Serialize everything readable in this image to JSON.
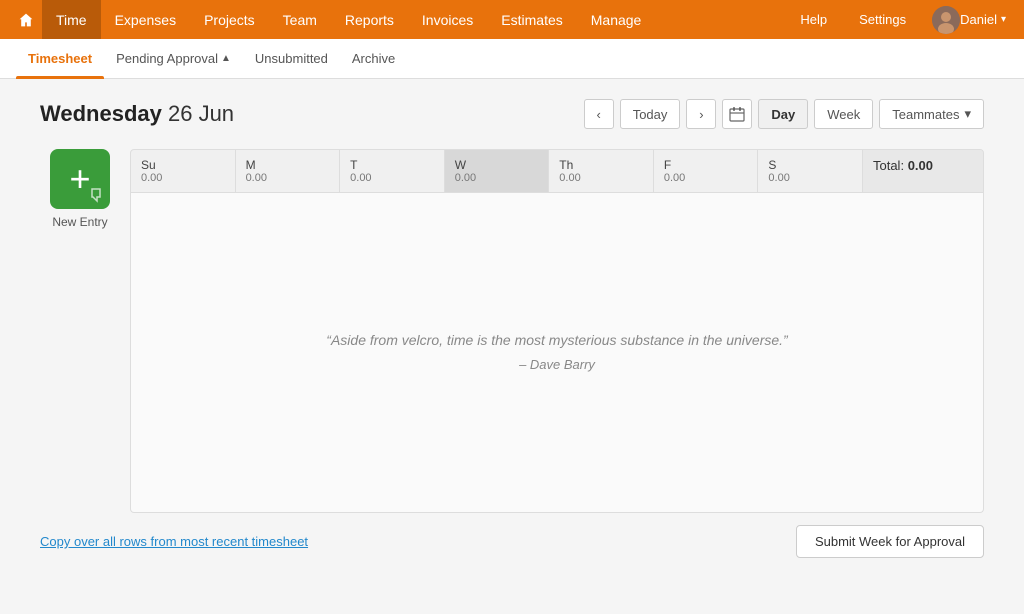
{
  "nav": {
    "home_icon": "⌂",
    "items": [
      {
        "label": "Time",
        "active": true
      },
      {
        "label": "Expenses",
        "active": false
      },
      {
        "label": "Projects",
        "active": false
      },
      {
        "label": "Team",
        "active": false
      },
      {
        "label": "Reports",
        "active": false
      },
      {
        "label": "Invoices",
        "active": false
      },
      {
        "label": "Estimates",
        "active": false
      },
      {
        "label": "Manage",
        "active": false
      }
    ],
    "help_label": "Help",
    "settings_label": "Settings",
    "user_label": "Daniel"
  },
  "sub_tabs": [
    {
      "label": "Timesheet",
      "active": true,
      "dot": false
    },
    {
      "label": "Pending Approval",
      "active": false,
      "dot": true
    },
    {
      "label": "Unsubmitted",
      "active": false,
      "dot": false
    },
    {
      "label": "Archive",
      "active": false,
      "dot": false
    }
  ],
  "date_display": {
    "day_name": "Wednesday",
    "date": "26 Jun"
  },
  "controls": {
    "prev_label": "‹",
    "next_label": "›",
    "today_label": "Today",
    "calendar_icon": "📅",
    "day_label": "Day",
    "week_label": "Week",
    "teammates_label": "Teammates",
    "chevron": "▾"
  },
  "new_entry": {
    "icon": "+",
    "label": "New Entry"
  },
  "grid": {
    "columns": [
      {
        "day": "Su",
        "value": "0.00"
      },
      {
        "day": "M",
        "value": "0.00"
      },
      {
        "day": "T",
        "value": "0.00"
      },
      {
        "day": "W",
        "value": "0.00",
        "active": true
      },
      {
        "day": "Th",
        "value": "0.00"
      },
      {
        "day": "F",
        "value": "0.00"
      },
      {
        "day": "S",
        "value": "0.00"
      }
    ],
    "total_label": "Total:",
    "total_value": "0.00",
    "quote": "“Aside from velcro, time is the most mysterious substance in the universe.”",
    "attribution": "– Dave Barry"
  },
  "footer": {
    "copy_link_label": "Copy over all rows from most recent timesheet",
    "submit_label": "Submit Week for Approval"
  }
}
